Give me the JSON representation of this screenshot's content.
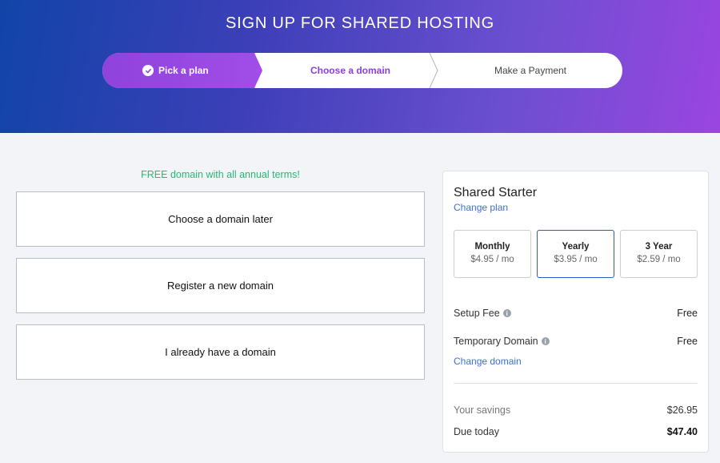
{
  "header": {
    "title": "SIGN UP FOR SHARED HOSTING"
  },
  "steps": [
    {
      "label": "Pick a plan",
      "state": "completed"
    },
    {
      "label": "Choose a domain",
      "state": "active"
    },
    {
      "label": "Make a Payment",
      "state": "upcoming"
    }
  ],
  "domain": {
    "note": "FREE domain with all annual terms!",
    "options": [
      {
        "label": "Choose a domain later"
      },
      {
        "label": "Register a new domain"
      },
      {
        "label": "I already have a domain"
      }
    ]
  },
  "summary": {
    "plan_name": "Shared Starter",
    "change_plan": "Change plan",
    "terms": [
      {
        "name": "Monthly",
        "price": "$4.95 / mo",
        "selected": false
      },
      {
        "name": "Yearly",
        "price": "$3.95 / mo",
        "selected": true
      },
      {
        "name": "3 Year",
        "price": "$2.59 / mo",
        "selected": false
      }
    ],
    "setup_fee": {
      "label": "Setup Fee",
      "value": "Free"
    },
    "temp_domain": {
      "label": "Temporary Domain",
      "value": "Free"
    },
    "change_domain": "Change domain",
    "savings": {
      "label": "Your savings",
      "value": "$26.95"
    },
    "due": {
      "label": "Due today",
      "value": "$47.40"
    }
  },
  "colors": {
    "accent_purple": "#8d3fd6",
    "link_blue": "#3f6ed8",
    "free_green": "#2bb673",
    "selected_border": "#2a5bc8"
  }
}
